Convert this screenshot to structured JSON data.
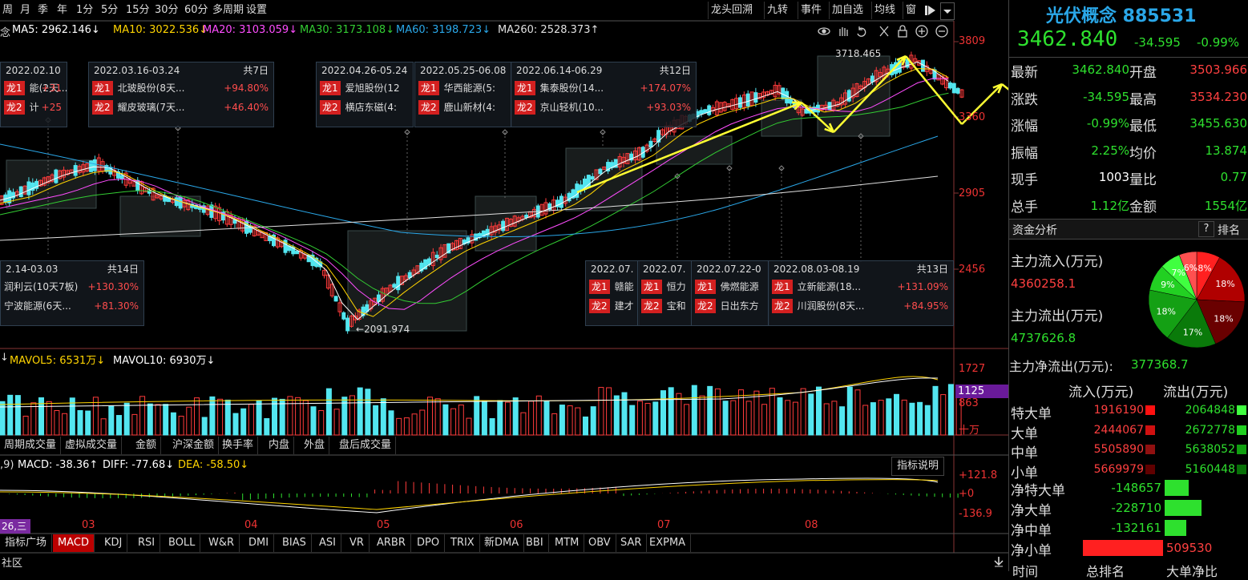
{
  "toolbar": {
    "periods": [
      "周",
      "月",
      "季",
      "年",
      "1分",
      "5分",
      "15分",
      "30分",
      "60分",
      "多周期",
      "设置"
    ],
    "right_tools": [
      "龙头回溯",
      "九转",
      "事件",
      "加自选",
      "均线",
      "窗"
    ]
  },
  "ma_line": {
    "prefix": "念",
    "ma5": "MA5: 2962.146↓",
    "ma10": "MA10: 3022.536↓",
    "ma20": "MA20: 3103.059↓",
    "ma30": "MA30: 3173.108↓",
    "ma60": "MA60: 3198.723↓",
    "ma260": "MA260: 2528.373↑"
  },
  "colors": {
    "ma5": "#ffffff",
    "ma10": "#ffd400",
    "ma20": "#ff4dff",
    "ma30": "#33cc33",
    "ma60": "#2aa7e8",
    "ma260": "#e0e0e0",
    "up": "#ff3b3b",
    "down": "#53e6f0"
  },
  "price_axis": [
    "3809",
    "3360",
    "2905",
    "2456"
  ],
  "price_annotations": {
    "high": "3718.465",
    "low": "2091.974"
  },
  "popups": [
    {
      "date": "2022.02.10",
      "rows": [
        {
          "tag": "龙1",
          "name": "能(2天...",
          "pct": "+31"
        },
        {
          "tag": "龙2",
          "name": "计",
          "pct": "+25"
        }
      ]
    },
    {
      "date": "2022.03.16-03.24",
      "count": "共7日",
      "rows": [
        {
          "tag": "龙1",
          "name": "北玻股份(8天...",
          "pct": "+94.80%"
        },
        {
          "tag": "龙2",
          "name": "耀皮玻璃(7天...",
          "pct": "+46.40%"
        }
      ]
    },
    {
      "date": "2022.04.26-05.24",
      "rows": [
        {
          "tag": "龙1",
          "name": "爱旭股份(12"
        },
        {
          "tag": "龙2",
          "name": "横店东磁(4:"
        }
      ]
    },
    {
      "date": "2022.05.25-06.08",
      "rows": [
        {
          "tag": "龙1",
          "name": "华西能源(5:"
        },
        {
          "tag": "龙2",
          "name": "鹿山新材(4:"
        }
      ]
    },
    {
      "date": "2022.06.14-06.29",
      "count": "共12日",
      "rows": [
        {
          "tag": "龙1",
          "name": "集泰股份(14...",
          "pct": "+174.07%"
        },
        {
          "tag": "龙2",
          "name": "京山轻机(10...",
          "pct": "+93.03%"
        }
      ]
    },
    {
      "date": "2.14-03.03",
      "count": "共14日",
      "rows": [
        {
          "tag": "",
          "name": "润利云(10天7板)",
          "pct": "+130.30%"
        },
        {
          "tag": "",
          "name": "宁波能源(6天...",
          "pct": "+81.30%"
        }
      ]
    },
    {
      "date": "2022.07.",
      "rows": [
        {
          "tag": "龙1",
          "name": "赣能"
        },
        {
          "tag": "龙2",
          "name": "建才"
        }
      ]
    },
    {
      "date": "2022.07.",
      "rows": [
        {
          "tag": "龙1",
          "name": "恒力"
        },
        {
          "tag": "龙2",
          "name": "宝和"
        }
      ]
    },
    {
      "date": "2022.07.22-0",
      "rows": [
        {
          "tag": "龙1",
          "name": "佛燃能源"
        },
        {
          "tag": "龙2",
          "name": "日出东方"
        }
      ]
    },
    {
      "date": "2022.08.03-08.19",
      "count": "共13日",
      "rows": [
        {
          "tag": "龙1",
          "name": "立新能源(18...",
          "pct": "+131.09%"
        },
        {
          "tag": "龙2",
          "name": "川润股份(8天...",
          "pct": "+84.95%"
        }
      ]
    }
  ],
  "volume": {
    "label_prefix": "↓",
    "mavol5": "MAVOL5: 6531万↓",
    "mavol10": "MAVOL10: 6930万↓",
    "axis": [
      "1727",
      "1125",
      "863",
      "十万"
    ]
  },
  "volume_tabs": [
    "周期成交量",
    "虚拟成交量",
    "金额",
    "沪深金额",
    "换手率",
    "内盘",
    "外盘",
    "盘后成交量"
  ],
  "macd": {
    "prefix": ",9)",
    "macd": "MACD: -38.36↑",
    "diff": "DIFF: -77.68↓",
    "dea": "DEA: -58.50↓",
    "explain": "指标说明",
    "axis": [
      "+121.8",
      "+0",
      "-136.9"
    ]
  },
  "months": [
    "03",
    "04",
    "05",
    "06",
    "07",
    "08"
  ],
  "date_badge": "26,三",
  "indicator_tabs": [
    "指标广场",
    "MACD",
    "KDJ",
    "RSI",
    "BOLL",
    "W&R",
    "DMI",
    "BIAS",
    "ASI",
    "VR",
    "ARBR",
    "DPO",
    "TRIX",
    "新DMA",
    "BBI",
    "MTM",
    "OBV",
    "SAR",
    "EXPMA"
  ],
  "bottom_label": "社区",
  "quote": {
    "title": "光伏概念 885531",
    "price": "3462.840",
    "change": "-34.595",
    "pct": "-0.99%",
    "rows": [
      {
        "l1": "最新",
        "v1": "3462.840",
        "l2": "开盘",
        "v2": "3503.966"
      },
      {
        "l1": "涨跌",
        "v1": "-34.595",
        "l2": "最高",
        "v2": "3534.230"
      },
      {
        "l1": "涨幅",
        "v1": "-0.99%",
        "l2": "最低",
        "v2": "3455.630"
      },
      {
        "l1": "振幅",
        "v1": "2.25%",
        "l2": "均价",
        "v2": "13.874"
      },
      {
        "l1": "现手",
        "v1": "1003",
        "l2": "量比",
        "v2": "0.77"
      },
      {
        "l1": "总手",
        "v1": "1.12亿",
        "l2": "金额",
        "v2": "1554亿"
      }
    ]
  },
  "funds": {
    "title": "资金分析",
    "q": "?",
    "rank": "排名",
    "inflow_label": "主力流入(万元)",
    "inflow": "4360258.1",
    "outflow_label": "主力流出(万元)",
    "outflow": "4737626.8",
    "net_label": "主力净流出(万元):",
    "net": "377368.7",
    "pie": [
      {
        "label": "8%",
        "value": 8,
        "color": "#ff2020"
      },
      {
        "label": "18%",
        "value": 18,
        "color": "#b00000"
      },
      {
        "label": "18%",
        "value": 18,
        "color": "#6a0000"
      },
      {
        "label": "17%",
        "value": 17,
        "color": "#0a7a0a"
      },
      {
        "label": "18%",
        "value": 18,
        "color": "#14a014"
      },
      {
        "label": "9%",
        "value": 9,
        "color": "#22d022"
      },
      {
        "label": "7%",
        "value": 7,
        "color": "#40ff40"
      },
      {
        "label": "6%",
        "value": 6,
        "color": "#ff5050"
      }
    ],
    "table_head": {
      "in": "流入(万元)",
      "out": "流出(万元)"
    },
    "table": [
      {
        "label": "特大单",
        "in": "1916190",
        "out": "2064848"
      },
      {
        "label": "大单",
        "in": "2444067",
        "out": "2672778"
      },
      {
        "label": "中单",
        "in": "5505890",
        "out": "5638052"
      },
      {
        "label": "小单",
        "in": "5669979",
        "out": "5160448"
      }
    ],
    "net_rows": [
      {
        "label": "净特大单",
        "value": "-148657",
        "bar": 0.3,
        "color": "#2ee02e"
      },
      {
        "label": "净大单",
        "value": "-228710",
        "bar": 0.46,
        "color": "#2ee02e"
      },
      {
        "label": "净中单",
        "value": "-132161",
        "bar": 0.27,
        "color": "#2ee02e"
      },
      {
        "label": "净小单",
        "value": "509530",
        "bar": 1.0,
        "color": "#ff2020"
      }
    ],
    "footer": [
      "时间",
      "总排名",
      "大单净比"
    ]
  }
}
